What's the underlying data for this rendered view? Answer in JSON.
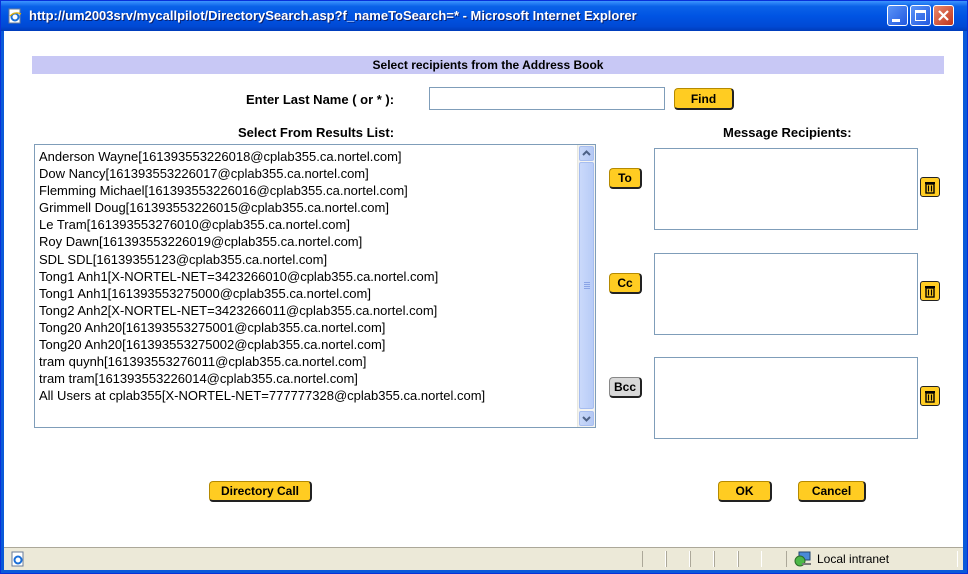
{
  "window": {
    "title": "http://um2003srv/mycallpilot/DirectorySearch.asp?f_nameToSearch=* - Microsoft Internet Explorer"
  },
  "page": {
    "header": "Select recipients from the Address Book",
    "search": {
      "label": "Enter Last Name ( or * ):",
      "value": "",
      "find_label": "Find"
    },
    "results": {
      "label": "Select From Results List:",
      "items": [
        "Anderson Wayne[161393553226018@cplab355.ca.nortel.com]",
        "Dow Nancy[161393553226017@cplab355.ca.nortel.com]",
        "Flemming Michael[161393553226016@cplab355.ca.nortel.com]",
        "Grimmell Doug[161393553226015@cplab355.ca.nortel.com]",
        "Le Tram[161393553276010@cplab355.ca.nortel.com]",
        "Roy Dawn[161393553226019@cplab355.ca.nortel.com]",
        "SDL SDL[16139355123@cplab355.ca.nortel.com]",
        "Tong1 Anh1[X-NORTEL-NET=3423266010@cplab355.ca.nortel.com]",
        "Tong1 Anh1[161393553275000@cplab355.ca.nortel.com]",
        "Tong2 Anh2[X-NORTEL-NET=3423266011@cplab355.ca.nortel.com]",
        "Tong20 Anh20[161393553275001@cplab355.ca.nortel.com]",
        "Tong20 Anh20[161393553275002@cplab355.ca.nortel.com]",
        "tram quynh[161393553276011@cplab355.ca.nortel.com]",
        "tram tram[161393553226014@cplab355.ca.nortel.com]",
        "All Users at cplab355[X-NORTEL-NET=777777328@cplab355.ca.nortel.com]"
      ]
    },
    "recipients": {
      "label": "Message Recipients:",
      "to_label": "To",
      "cc_label": "Cc",
      "bcc_label": "Bcc"
    },
    "buttons": {
      "directory_call": "Directory Call",
      "ok": "OK",
      "cancel": "Cancel"
    }
  },
  "statusbar": {
    "zone": "Local intranet"
  },
  "colors": {
    "titlebar": "#0054e3",
    "button": "#ffcc22",
    "header_bar": "#c8c8f5"
  }
}
